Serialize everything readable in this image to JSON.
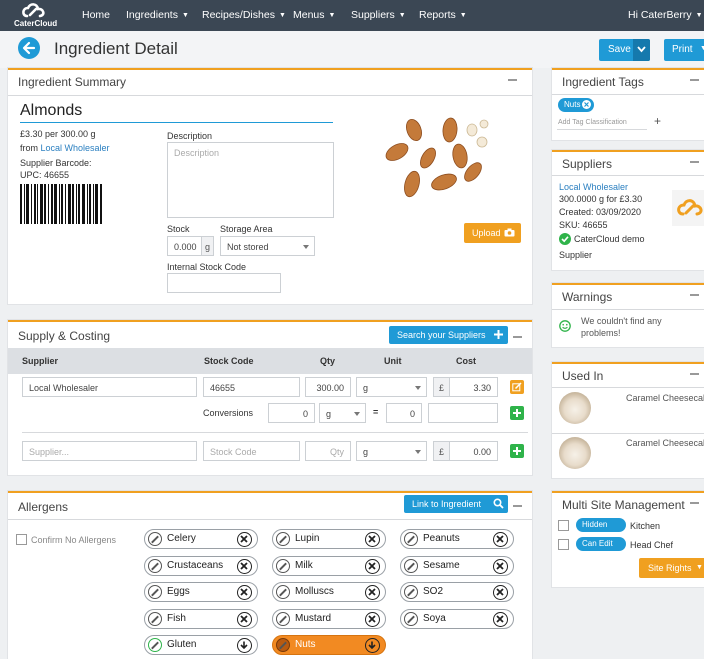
{
  "app": {
    "logo_text": "CaterCloud"
  },
  "nav": {
    "items": [
      "Home",
      "Ingredients",
      "Recipes/Dishes",
      "Menus",
      "Suppliers",
      "Reports"
    ],
    "user": "Hi CaterBerry"
  },
  "page": {
    "title": "Ingredient Detail",
    "save_label": "Save",
    "print_label": "Print"
  },
  "summary": {
    "header": "Ingredient Summary",
    "name": "Almonds",
    "price_line": "£3.30 per 300.00 g",
    "from_label": "from",
    "supplier": "Local Wholesaler",
    "barcode_label": "Supplier Barcode:",
    "upc": "UPC: 46655",
    "description_label": "Description",
    "description_placeholder": "Description",
    "stock_label": "Stock",
    "stock_value": "0.000",
    "stock_unit": "g",
    "storage_label": "Storage Area",
    "storage_value": "Not stored",
    "internal_code_label": "Internal Stock Code",
    "upload_label": "Upload"
  },
  "supply": {
    "header": "Supply & Costing",
    "search_label": "Search your Suppliers",
    "columns": [
      "Supplier",
      "Stock Code",
      "Qty",
      "Unit",
      "Cost"
    ],
    "row": {
      "supplier": "Local Wholesaler",
      "stock_code": "46655",
      "qty": "300.00",
      "unit": "g",
      "currency": "£",
      "cost": "3.30"
    },
    "conversions_label": "Conversions",
    "conv_from": "0",
    "conv_unit": "g",
    "conv_eq": "=",
    "conv_to": "0",
    "new_row": {
      "supplier_ph": "Supplier...",
      "stock_code_ph": "Stock Code",
      "qty_ph": "Qty",
      "unit": "g",
      "currency": "£",
      "cost": "0.00"
    }
  },
  "allergens": {
    "header": "Allergens",
    "link_label": "Link to Ingredient",
    "confirm_none": "Confirm No Allergens",
    "items": [
      {
        "label": "Celery",
        "active": false
      },
      {
        "label": "Lupin",
        "active": false
      },
      {
        "label": "Peanuts",
        "active": false
      },
      {
        "label": "Crustaceans",
        "active": false
      },
      {
        "label": "Milk",
        "active": false
      },
      {
        "label": "Sesame",
        "active": false
      },
      {
        "label": "Eggs",
        "active": false
      },
      {
        "label": "Molluscs",
        "active": false
      },
      {
        "label": "SO2",
        "active": false
      },
      {
        "label": "Fish",
        "active": false
      },
      {
        "label": "Mustard",
        "active": false
      },
      {
        "label": "Soya",
        "active": false
      },
      {
        "label": "Gluten",
        "active": false
      },
      {
        "label": "Nuts",
        "active": true
      }
    ]
  },
  "tags": {
    "header": "Ingredient Tags",
    "tag": "Nuts",
    "add_placeholder": "Add Tag Classification"
  },
  "suppliers_panel": {
    "header": "Suppliers",
    "name": "Local Wholesaler",
    "price": "300.0000 g for £3.30",
    "created": "Created: 03/09/2020",
    "sku": "SKU: 46655",
    "account": "CaterCloud demo",
    "account2": "Supplier"
  },
  "warnings": {
    "header": "Warnings",
    "line1": "We couldn't find any",
    "line2": "problems!"
  },
  "used_in": {
    "header": "Used In",
    "items": [
      "Caramel Cheesecake",
      "Caramel Cheesecake"
    ]
  },
  "multisite": {
    "header": "Multi Site Management",
    "rows": [
      {
        "badge": "Hidden",
        "label": "Kitchen"
      },
      {
        "badge": "Can Edit",
        "label": "Head Chef"
      }
    ],
    "rights_label": "Site Rights"
  },
  "colors": {
    "accent": "#1f9ad6",
    "warning": "#f0a020",
    "success": "#2fb34a",
    "nav": "#3b4754",
    "active_allergen": "#f28a22"
  }
}
